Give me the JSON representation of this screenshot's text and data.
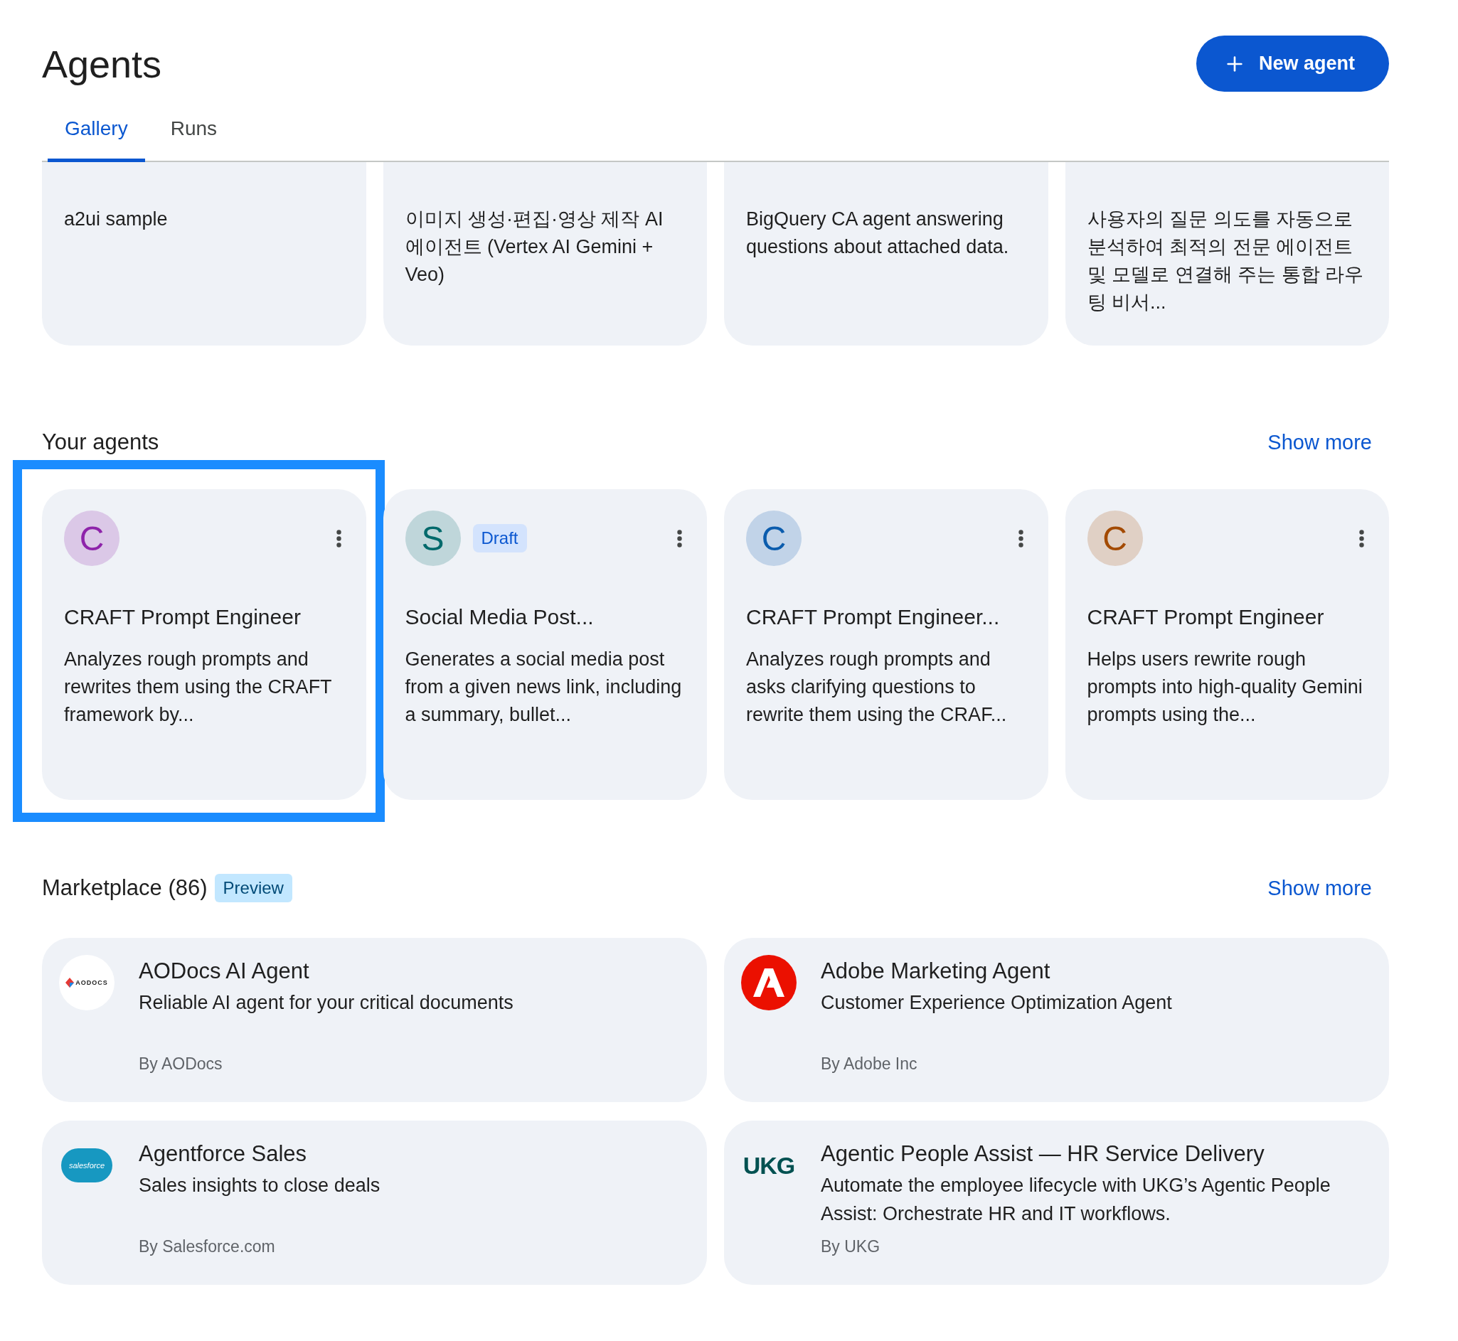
{
  "page": {
    "title": "Agents",
    "new_button": "New agent"
  },
  "tabs": [
    {
      "label": "Gallery",
      "selected": true
    },
    {
      "label": "Runs",
      "selected": false
    }
  ],
  "gallery": [
    {
      "description": "a2ui sample"
    },
    {
      "description": "이미지 생성·편집·영상 제작 AI 에이전트 (Vertex AI Gemini + Veo)"
    },
    {
      "description": "BigQuery CA agent answering questions about attached data."
    },
    {
      "description": "사용자의 질문 의도를 자동으로 분석하여 최적의 전문 에이전트 및 모델로 연결해 주는 통합 라우팅 비서..."
    }
  ],
  "your_agents": {
    "heading": "Your agents",
    "show_more": "Show more",
    "cards": [
      {
        "initial": "C",
        "color": "#8e24aa",
        "draft": false,
        "highlighted": true,
        "title": "CRAFT Prompt Engineer",
        "description": "Analyzes rough prompts and rewrites them using the CRAFT framework by..."
      },
      {
        "initial": "S",
        "color": "#00696b",
        "draft": true,
        "draft_label": "Draft",
        "highlighted": false,
        "title": "Social Media Post...",
        "description": "Generates a social media post from a given news link, including a summary, bullet..."
      },
      {
        "initial": "C",
        "color": "#0b5cad",
        "draft": false,
        "highlighted": false,
        "title": "CRAFT Prompt Engineer...",
        "description": "Analyzes rough prompts and asks clarifying questions to rewrite them using the CRAF..."
      },
      {
        "initial": "C",
        "color": "#a34a00",
        "draft": false,
        "highlighted": false,
        "title": "CRAFT Prompt Engineer",
        "description": "Helps users rewrite rough prompts into high-quality Gemini prompts using the..."
      }
    ]
  },
  "marketplace": {
    "heading": "Marketplace (86)",
    "badge": "Preview",
    "show_more": "Show more",
    "cards": [
      {
        "kind": "aodocs",
        "logo_text": "AODOCS",
        "title": "AODocs AI Agent",
        "description": "Reliable AI agent for your critical documents",
        "by": "By AODocs"
      },
      {
        "kind": "adobe",
        "title": "Adobe Marketing Agent",
        "description": "Customer Experience Optimization Agent",
        "by": "By Adobe Inc"
      },
      {
        "kind": "salesforce",
        "logo_text": "salesforce",
        "title": "Agentforce Sales",
        "description": "Sales insights to close deals",
        "by": "By Salesforce.com"
      },
      {
        "kind": "ukg",
        "logo_text": "UKG",
        "title": "Agentic People Assist — HR Service Delivery",
        "description": "Automate the employee lifecycle with UKG’s Agentic People Assist: Orchestrate HR and IT workflows.",
        "by": "By UKG"
      }
    ]
  }
}
